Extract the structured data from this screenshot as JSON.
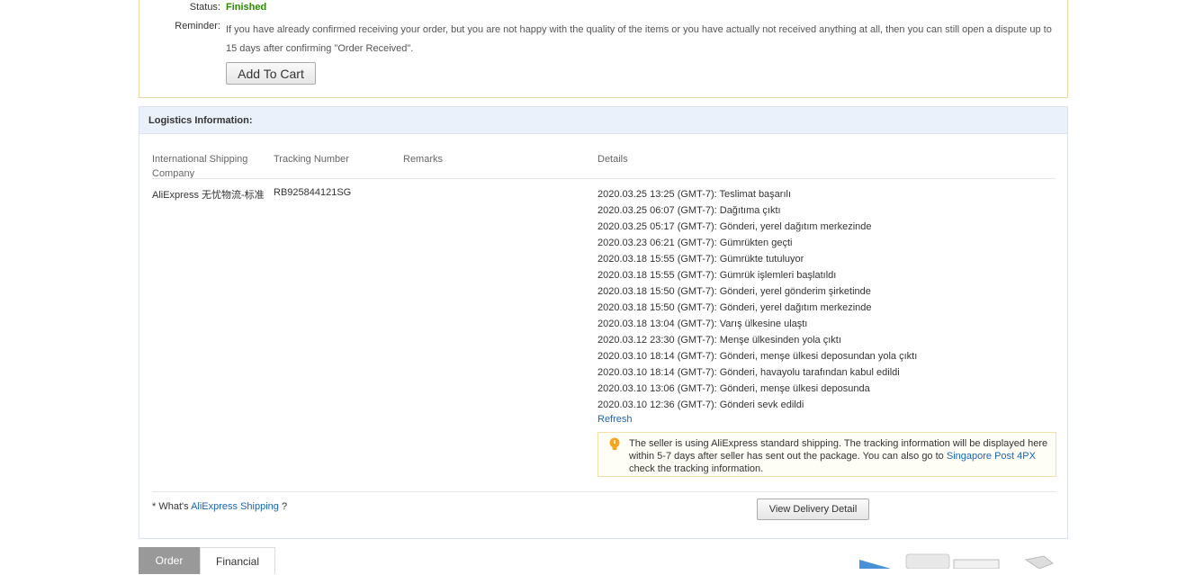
{
  "order": {
    "status_label": "Status:",
    "status_value": "Finished",
    "reminder_label": "Reminder:",
    "reminder_text": "If you have already confirmed receiving your order, but you are not happy with the quality of the items or you have actually not received anything at all, then you can still open a dispute up to 15 days after confirming \"Order Received\".",
    "add_to_cart": "Add To Cart"
  },
  "logistics": {
    "title": "Logistics Information:",
    "columns": [
      "International Shipping Company",
      "Tracking Number",
      "Remarks",
      "Details"
    ],
    "company": "AliExpress 无忧物流-标准",
    "tracking_number": "RB925844121SG",
    "events": [
      "2020.03.25 13:25 (GMT-7): Teslimat başarılı",
      "2020.03.25 06:07 (GMT-7): Dağıtıma çıktı",
      "2020.03.25 05:17 (GMT-7): Gönderi, yerel dağıtım merkezinde",
      "2020.03.23 06:21 (GMT-7): Gümrükten geçti",
      "2020.03.18 15:55 (GMT-7): Gümrükte tutuluyor",
      "2020.03.18 15:55 (GMT-7): Gümrük işlemleri başlatıldı",
      "2020.03.18 15:50 (GMT-7): Gönderi, yerel gönderim şirketinde",
      "2020.03.18 15:50 (GMT-7): Gönderi, yerel dağıtım merkezinde",
      "2020.03.18 13:04 (GMT-7): Varış ülkesine ulaştı",
      "2020.03.12 23:30 (GMT-7): Menşe ülkesinden yola çıktı",
      "2020.03.10 18:14 (GMT-7): Gönderi, menşe ülkesi deposundan yola çıktı",
      "2020.03.10 18:14 (GMT-7): Gönderi, havayolu tarafından kabul edildi",
      "2020.03.10 13:06 (GMT-7): Gönderi, menşe ülkesi deposunda",
      "2020.03.10 12:36 (GMT-7): Gönderi sevk edildi"
    ],
    "refresh": "Refresh",
    "notice_text": "The seller is using AliExpress standard shipping. The tracking information will be displayed here within 5-7 days after seller has sent out the package. You can also go to",
    "notice_link": "Singapore Post 4PX",
    "notice_tail": "check the tracking information.",
    "notice_icon": "lightbulb-icon",
    "whats_prefix": "* What's",
    "whats_link": "AliExpress Shipping",
    "whats_suffix": "?",
    "view_delivery": "View Delivery Detail"
  },
  "tabs": [
    "Order",
    "Financial"
  ],
  "colors": {
    "status": "#2a8a00",
    "link": "#1a66b3",
    "header_bg": "#eaf1fb"
  }
}
